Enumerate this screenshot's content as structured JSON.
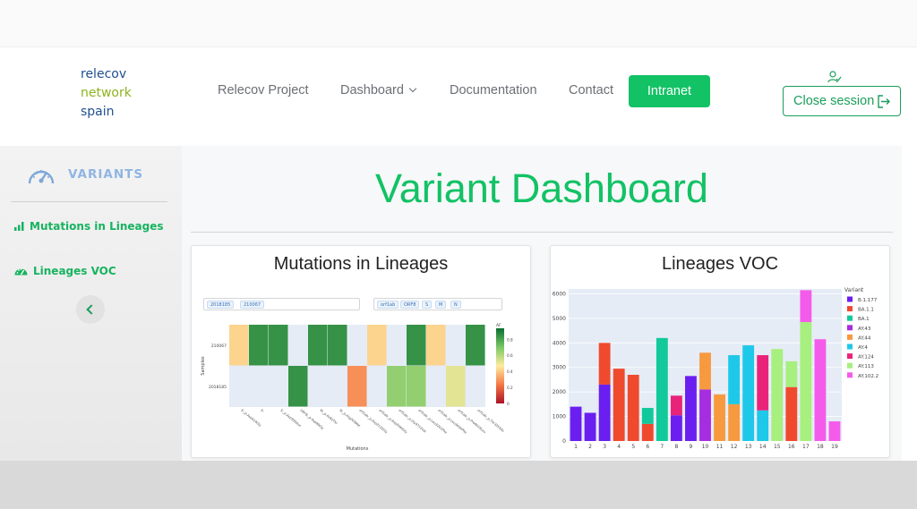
{
  "logo": {
    "line1": "relecov",
    "line2": "network",
    "line3": "spain"
  },
  "nav": {
    "project": "Relecov Project",
    "dashboard": "Dashboard",
    "documentation": "Documentation",
    "contact": "Contact",
    "intranet": "Intranet",
    "close_session": "Close session"
  },
  "sidebar": {
    "title": "VARIANTS",
    "items": [
      {
        "label": "Mutations in Lineages",
        "icon": "bar-chart-icon"
      },
      {
        "label": "Lineages VOC",
        "icon": "tachometer-icon"
      }
    ]
  },
  "page": {
    "title": "Variant Dashboard"
  },
  "colors": {
    "brand_green": "#12c265",
    "sidebar_title": "#8fb5e3",
    "logo_blue": "#1f4f8f",
    "logo_green": "#8cb31f"
  },
  "chart_data": [
    {
      "type": "heatmap",
      "title": "Mutations in Lineages",
      "filters": {
        "samples": [
          "2018185",
          "210067"
        ],
        "genes": [
          "orf1ab",
          "ORF8",
          "S",
          "M",
          "N"
        ]
      },
      "ylabel": "Samples",
      "xlabel": "Mutations",
      "y": [
        "210067",
        "2018185"
      ],
      "x": [
        "S:_p.Asp614Gly",
        "S:",
        "S:_p.Asp950Asn",
        "ORF8:_p.Asp89Gly",
        "M:_p.Ile82Thr",
        "N:_p.Arg203Met",
        "orf1ab:_p.Asp2132Gly",
        "orf1ab:_p.Asp2046Gly",
        "orf1ab:_p.Gly4712Val",
        "orf1ab:_p.Leu3201Phe",
        "orf1ab:_p.Leu3606Phe",
        "orf1ab:_p.Pro4619Leu",
        "orf1ab:_p.Thr3255Ile"
      ],
      "z": [
        [
          0.45,
          0.9,
          0.9,
          null,
          0.9,
          0.9,
          null,
          0.45,
          null,
          0.9,
          0.45,
          null,
          0.9
        ],
        [
          null,
          null,
          null,
          0.9,
          null,
          null,
          0.3,
          null,
          0.7,
          0.7,
          null,
          0.55,
          null
        ]
      ],
      "colorbar": {
        "label": "AF",
        "ticks": [
          0.8,
          0.6,
          0.4,
          0.2,
          0
        ]
      }
    },
    {
      "type": "bar",
      "title": "Lineages VOC",
      "legend_title": "Variant",
      "legend_position": "right",
      "categories": [
        "1",
        "2",
        "3",
        "4",
        "5",
        "6",
        "7",
        "8",
        "9",
        "10",
        "11",
        "12",
        "13",
        "14",
        "15",
        "16",
        "17",
        "18",
        "19"
      ],
      "ylim": [
        0,
        6200
      ],
      "yticks": [
        0,
        1000,
        2000,
        3000,
        4000,
        5000,
        6000
      ],
      "series": [
        {
          "name": "B.1.177",
          "color": "#6a1ff0",
          "values": [
            1400,
            1150,
            2300,
            0,
            0,
            0,
            0,
            1050,
            2650,
            0,
            0,
            0,
            0,
            0,
            0,
            0,
            0,
            0,
            0
          ]
        },
        {
          "name": "BA.1.1",
          "color": "#ef4a2e",
          "values": [
            0,
            0,
            1700,
            2950,
            2700,
            700,
            0,
            0,
            0,
            0,
            0,
            0,
            0,
            0,
            0,
            2200,
            0,
            0,
            0
          ]
        },
        {
          "name": "BA.1",
          "color": "#11c99a",
          "values": [
            0,
            0,
            0,
            0,
            0,
            650,
            4200,
            0,
            0,
            0,
            0,
            0,
            0,
            0,
            0,
            0,
            0,
            0,
            0
          ]
        },
        {
          "name": "AY.43",
          "color": "#a62de0",
          "values": [
            0,
            0,
            0,
            0,
            0,
            0,
            0,
            0,
            0,
            2100,
            0,
            0,
            0,
            0,
            0,
            0,
            0,
            0,
            0
          ]
        },
        {
          "name": "AY.44",
          "color": "#f79a3f",
          "values": [
            0,
            0,
            0,
            0,
            0,
            0,
            0,
            0,
            0,
            1500,
            1900,
            1500,
            0,
            0,
            0,
            0,
            0,
            0,
            0
          ]
        },
        {
          "name": "AY.4",
          "color": "#1ec8e8",
          "values": [
            0,
            0,
            0,
            0,
            0,
            0,
            0,
            0,
            0,
            0,
            0,
            2000,
            3900,
            1250,
            0,
            0,
            0,
            0,
            0
          ]
        },
        {
          "name": "AY.124",
          "color": "#e9237a",
          "values": [
            0,
            0,
            0,
            0,
            0,
            0,
            0,
            800,
            0,
            0,
            0,
            0,
            0,
            2250,
            0,
            0,
            0,
            0,
            0
          ]
        },
        {
          "name": "AY.113",
          "color": "#a7ef7e",
          "values": [
            0,
            0,
            0,
            0,
            0,
            0,
            0,
            0,
            0,
            0,
            0,
            0,
            0,
            0,
            3750,
            1050,
            4850,
            0,
            0
          ]
        },
        {
          "name": "AY.102.2",
          "color": "#f55bea",
          "values": [
            0,
            0,
            0,
            0,
            0,
            0,
            0,
            0,
            0,
            0,
            0,
            0,
            0,
            0,
            0,
            0,
            1300,
            4150,
            800
          ]
        }
      ]
    }
  ]
}
